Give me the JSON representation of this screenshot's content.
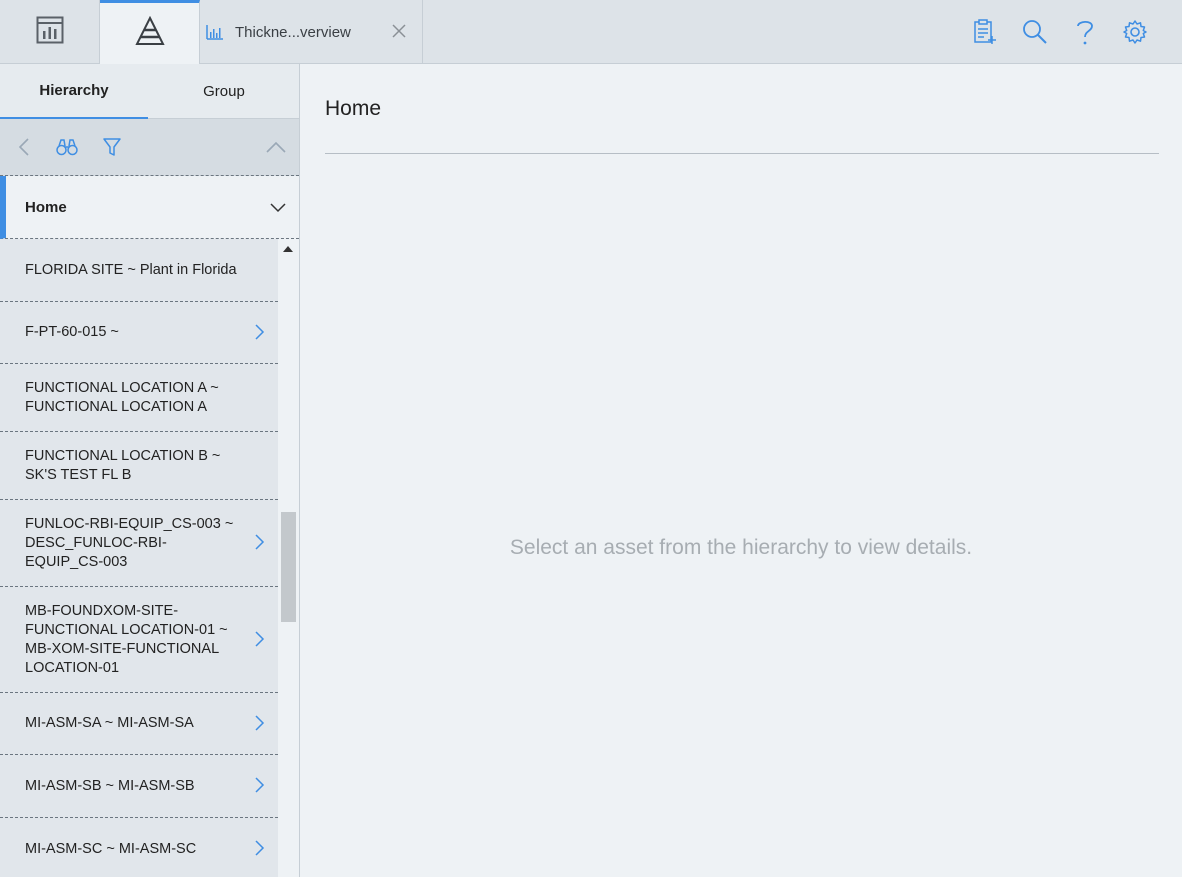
{
  "topbar": {
    "tab_label": "Thickne...verview",
    "icons": [
      "dashboard-icon",
      "asset-hierarchy-icon",
      "chart-icon",
      "close-icon",
      "add-document-icon",
      "search-icon",
      "help-icon",
      "settings-icon"
    ]
  },
  "sidebar": {
    "tabs": [
      {
        "label": "Hierarchy",
        "active": true
      },
      {
        "label": "Group",
        "active": false
      }
    ],
    "toolbar_icons": [
      "back-icon",
      "binoculars-icon",
      "filter-icon",
      "collapse-icon"
    ],
    "home_label": "Home",
    "items": [
      {
        "label": "FLORIDA SITE ~ Plant in Florida",
        "has_children": false
      },
      {
        "label": "F-PT-60-015 ~",
        "has_children": true
      },
      {
        "label": "FUNCTIONAL LOCATION A ~ FUNCTIONAL LOCATION A",
        "has_children": false
      },
      {
        "label": "FUNCTIONAL LOCATION B ~ SK'S TEST FL B",
        "has_children": false
      },
      {
        "label": "FUNLOC-RBI-EQUIP_CS-003 ~ DESC_FUNLOC-RBI-EQUIP_CS-003",
        "has_children": true
      },
      {
        "label": "MB-FOUNDXOM-SITE-FUNCTIONAL LOCATION-01 ~ MB-XOM-SITE-FUNCTIONAL LOCATION-01",
        "has_children": true
      },
      {
        "label": "MI-ASM-SA ~ MI-ASM-SA",
        "has_children": true
      },
      {
        "label": "MI-ASM-SB ~ MI-ASM-SB",
        "has_children": true
      },
      {
        "label": "MI-ASM-SC ~ MI-ASM-SC",
        "has_children": true
      }
    ]
  },
  "main": {
    "title": "Home",
    "empty_message": "Select an asset from the hierarchy to view details."
  },
  "colors": {
    "accent": "#3f8ee3",
    "icon_blue": "#3f8ee3"
  }
}
